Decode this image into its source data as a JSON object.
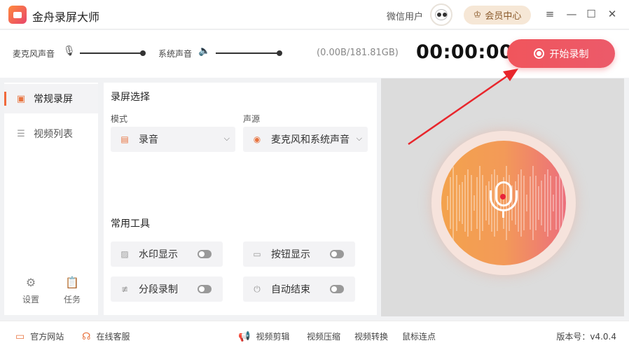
{
  "app": {
    "title": "金舟录屏大师",
    "user_name": "微信用户",
    "vip_label": "会员中心"
  },
  "audio": {
    "mic_label": "麦克风声音",
    "system_label": "系统声音",
    "storage": "(0.00B/181.81GB)",
    "timer": "00:00:00",
    "start_label": "开始录制"
  },
  "sidebar": {
    "items": [
      {
        "label": "常规录屏",
        "icon": "video-camera-icon"
      },
      {
        "label": "视频列表",
        "icon": "list-icon"
      }
    ],
    "settings_label": "设置",
    "tasks_label": "任务"
  },
  "panel": {
    "section_title": "录屏选择",
    "mode_label": "模式",
    "mode_value": "录音",
    "source_label": "声源",
    "source_value": "麦克风和系统声音",
    "tools_title": "常用工具",
    "tools": [
      {
        "label": "水印显示",
        "enabled": false
      },
      {
        "label": "按钮显示",
        "enabled": false
      },
      {
        "label": "分段录制",
        "enabled": false
      },
      {
        "label": "自动结束",
        "enabled": false
      }
    ]
  },
  "bottom": {
    "website": "官方网站",
    "service": "在线客服",
    "tools": [
      "视频剪辑",
      "视频压缩",
      "视频转换",
      "鼠标连点"
    ],
    "version": "版本号：v4.0.4"
  },
  "colors": {
    "accent": "#f0555c",
    "orange": "#e8733f"
  }
}
